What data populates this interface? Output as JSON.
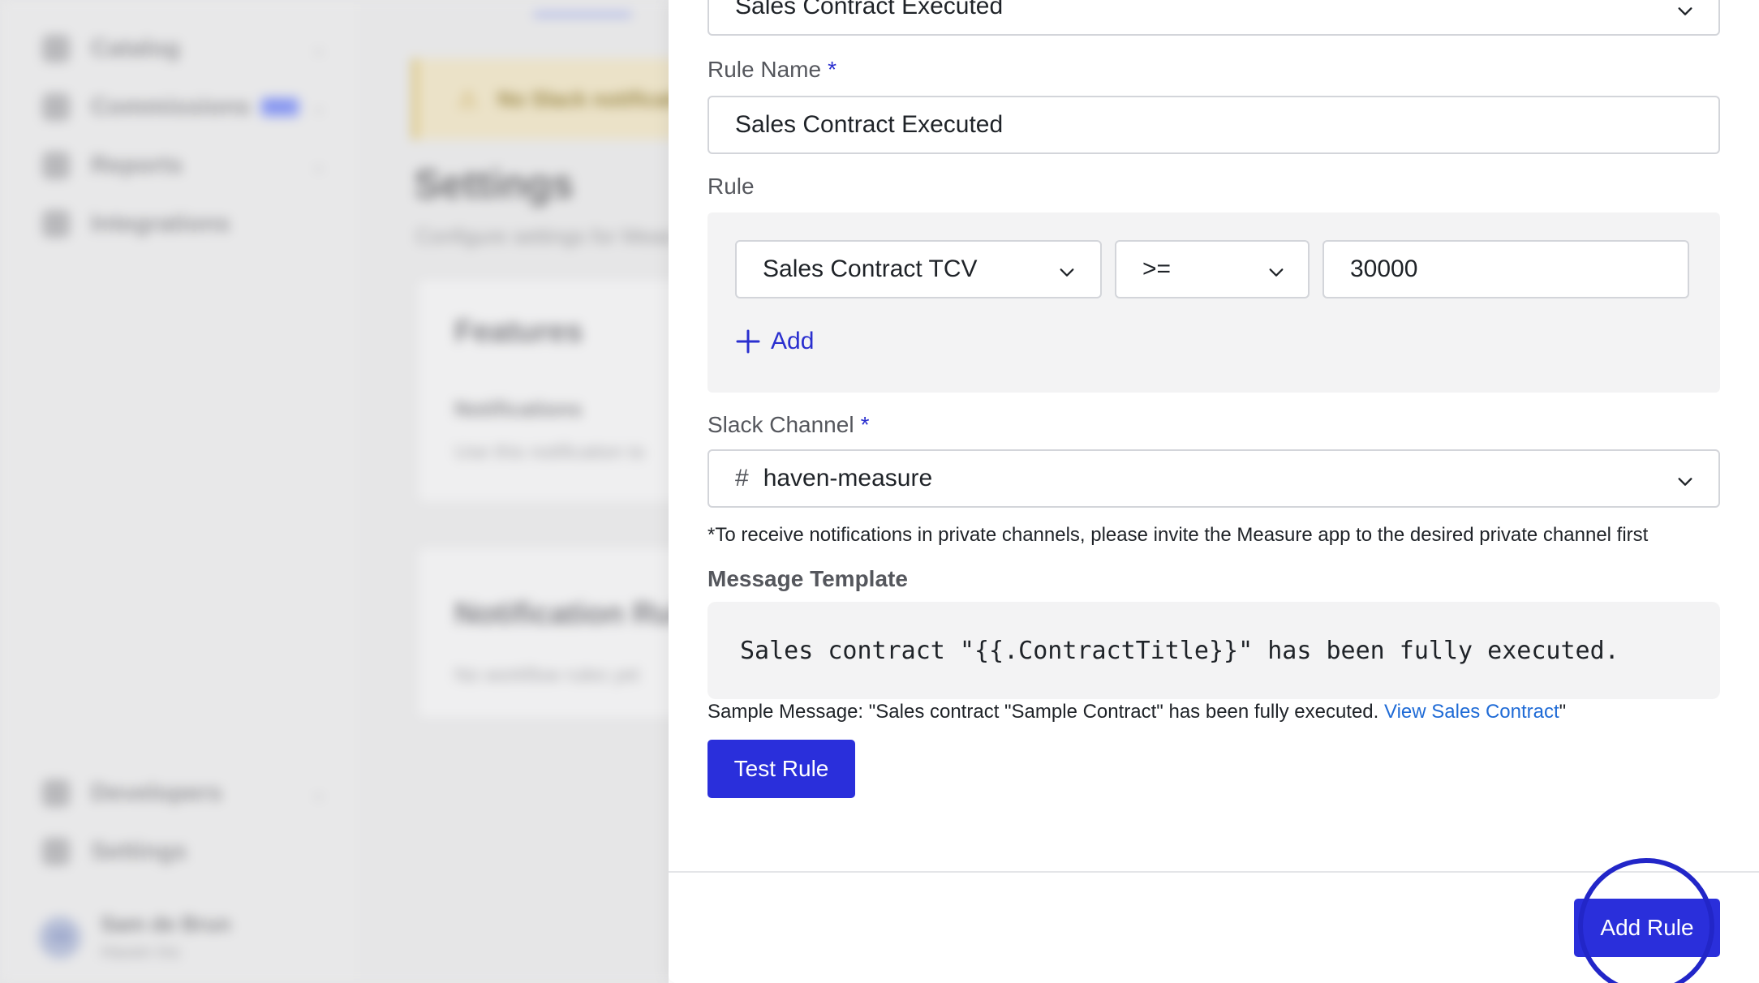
{
  "background": {
    "sidebar": {
      "items": [
        {
          "label": "Catalog",
          "icon": "catalog-icon"
        },
        {
          "label": "Commissions",
          "icon": "commissions-icon",
          "badge": "New"
        },
        {
          "label": "Reports",
          "icon": "reports-icon"
        },
        {
          "label": "Integrations",
          "icon": "integrations-icon"
        }
      ],
      "bottom_items": [
        {
          "label": "Developers",
          "icon": "code-icon"
        },
        {
          "label": "Settings",
          "icon": "gear-icon"
        }
      ],
      "user": {
        "initials": "SB",
        "name": "Sam de Brun",
        "org": "Haven Inc"
      }
    },
    "main": {
      "banner_text": "No Slack notifications",
      "title": "Settings",
      "subtitle": "Configure settings for Measure",
      "features_card": {
        "title": "Features",
        "item_title": "Notifications",
        "item_text": "Use this notification to"
      },
      "rules_card": {
        "title": "Notification Rules",
        "text": "No workflow rules yet"
      }
    }
  },
  "drawer": {
    "event_select": {
      "value": "Sales Contract Executed"
    },
    "rule_name": {
      "label": "Rule Name",
      "required": "*",
      "value": "Sales Contract Executed"
    },
    "rule": {
      "label": "Rule",
      "field": "Sales Contract TCV",
      "operator": ">=",
      "value": "30000",
      "add_label": "Add"
    },
    "slack_channel": {
      "label": "Slack Channel",
      "required": "*",
      "prefix": "#",
      "value": "haven-measure"
    },
    "hint": "*To receive notifications in private channels, please invite the Measure app to the desired private channel first",
    "message_template": {
      "label": "Message Template",
      "value": "Sales contract \"{{.ContractTitle}}\" has been fully executed."
    },
    "sample": {
      "prefix": "Sample Message: \"Sales contract \"Sample Contract\" has been fully executed. ",
      "link": "View Sales Contract",
      "suffix": "\""
    },
    "test_button": "Test Rule",
    "add_button": "Add Rule"
  },
  "colors": {
    "accent": "#2a2fdb",
    "link": "#1f6bd6",
    "required": "#2a2fcf"
  }
}
